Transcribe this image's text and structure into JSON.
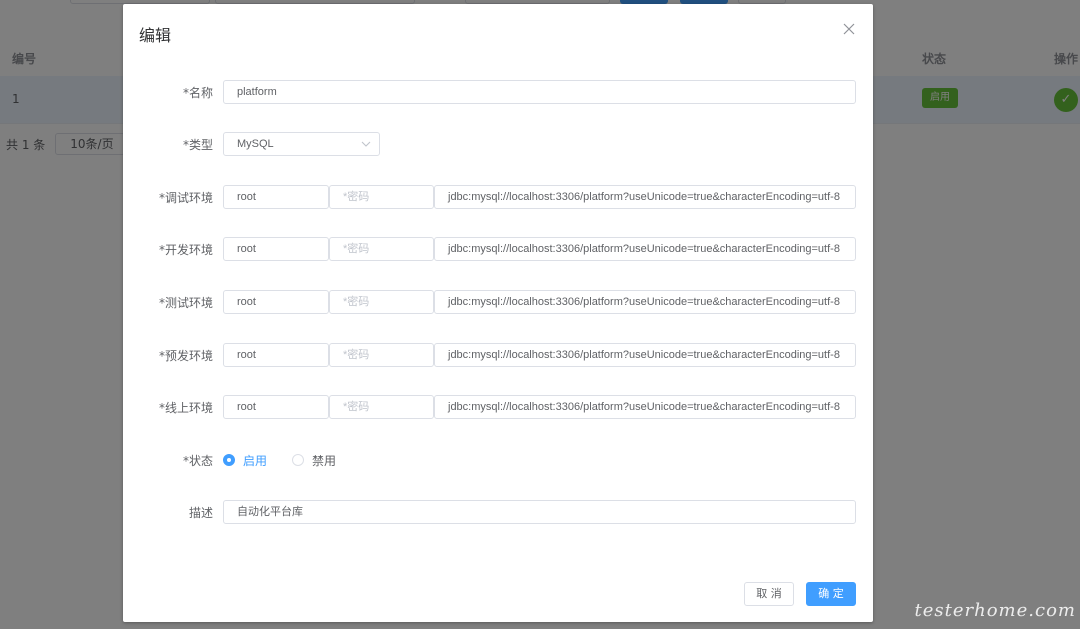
{
  "background": {
    "columns": {
      "num": "编号",
      "status": "状态",
      "action": "操作"
    },
    "row": {
      "num": "1",
      "status_badge": "启用"
    },
    "pager": {
      "total": "共 1 条",
      "page_size": "10条/页"
    }
  },
  "dialog": {
    "title": "编辑",
    "fields": {
      "name": {
        "label": "*名称",
        "value": "platform"
      },
      "type": {
        "label": "*类型",
        "value": "MySQL"
      },
      "environments": [
        {
          "label": "*调试环境",
          "user": "root",
          "password_placeholder": "*密码",
          "url": "jdbc:mysql://localhost:3306/platform?useUnicode=true&characterEncoding=utf-8"
        },
        {
          "label": "*开发环境",
          "user": "root",
          "password_placeholder": "*密码",
          "url": "jdbc:mysql://localhost:3306/platform?useUnicode=true&characterEncoding=utf-8"
        },
        {
          "label": "*测试环境",
          "user": "root",
          "password_placeholder": "*密码",
          "url": "jdbc:mysql://localhost:3306/platform?useUnicode=true&characterEncoding=utf-8"
        },
        {
          "label": "*预发环境",
          "user": "root",
          "password_placeholder": "*密码",
          "url": "jdbc:mysql://localhost:3306/platform?useUnicode=true&characterEncoding=utf-8"
        },
        {
          "label": "*线上环境",
          "user": "root",
          "password_placeholder": "*密码",
          "url": "jdbc:mysql://localhost:3306/platform?useUnicode=true&characterEncoding=utf-8"
        }
      ],
      "status": {
        "label": "*状态",
        "options": [
          "启用",
          "禁用"
        ],
        "selected": "启用"
      },
      "description": {
        "label": "描述",
        "value": "自动化平台库"
      }
    },
    "buttons": {
      "cancel": "取 消",
      "ok": "确 定"
    }
  },
  "watermark": "testerhome.com",
  "colors": {
    "primary": "#409eff",
    "success": "#67c23a",
    "border": "#dcdfe6",
    "placeholder": "#c0c4cc"
  }
}
